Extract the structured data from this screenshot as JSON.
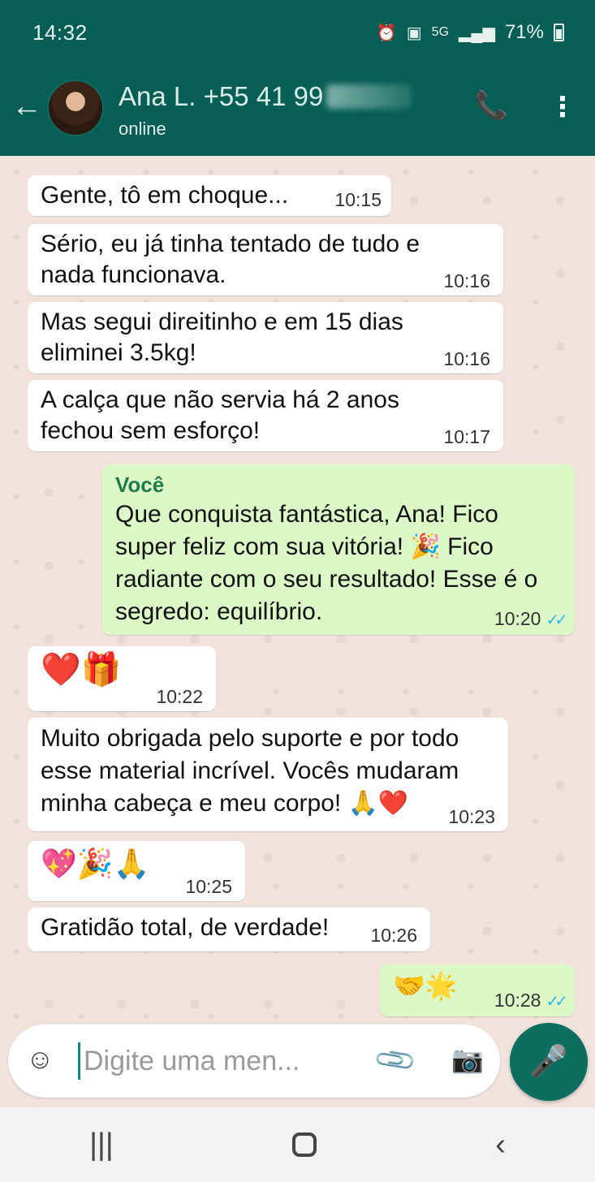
{
  "status_bar": {
    "time": "14:32",
    "network": "5G",
    "battery": "71%"
  },
  "header": {
    "contact_name": "Ana L. +55 41 99",
    "contact_status": "online"
  },
  "messages": [
    {
      "direction": "in",
      "text": "Gente, tô em choque...",
      "time": "10:15"
    },
    {
      "direction": "in",
      "text": "Sério, eu já tinha tentado de tudo e nada funcionava.",
      "time": "10:16"
    },
    {
      "direction": "in",
      "text": "Mas segui direitinho e em 15 dias eliminei 3.5kg!",
      "time": "10:16"
    },
    {
      "direction": "in",
      "text": "A calça que não servia há 2 anos fechou sem esforço!",
      "time": "10:17"
    },
    {
      "direction": "out",
      "sender": "Você",
      "text": "Que conquista fantástica, Ana! Fico super feliz com sua vitória! 🎉 Fico radiante com o seu resultado! Esse é o segredo: equilíbrio.",
      "time": "10:20"
    },
    {
      "direction": "in",
      "text": "❤️🎁",
      "time": "10:22"
    },
    {
      "direction": "in",
      "text": "Muito obrigada pelo suporte e por todo esse material incrível. Vocês mudaram minha cabeça e meu corpo! 🙏❤️",
      "time": "10:23"
    },
    {
      "direction": "in",
      "text": "💖🎉🙏",
      "time": "10:25"
    },
    {
      "direction": "in",
      "text": "Gratidão total, de verdade!",
      "time": "10:26"
    },
    {
      "direction": "out",
      "text": "🤝🌟",
      "time": "10:28"
    }
  ],
  "composer": {
    "placeholder": "Digite uma men..."
  },
  "colors": {
    "header": "#075e54",
    "outgoing_bubble": "#dcf8c6",
    "incoming_bubble": "#ffffff",
    "read_ticks": "#34b7f1",
    "mic_button": "#0b6e5f"
  },
  "icons": [
    "back-arrow-icon",
    "add-call-icon",
    "more-vert-icon",
    "emoji-icon",
    "attach-icon",
    "camera-icon",
    "mic-icon"
  ]
}
